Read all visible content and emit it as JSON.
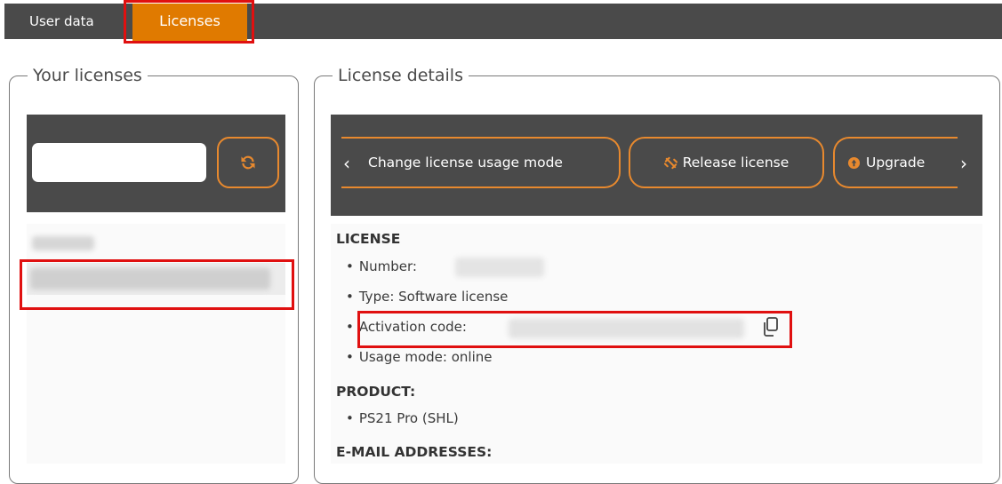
{
  "tabs": {
    "user_data": "User data",
    "licenses": "Licenses"
  },
  "left_panel": {
    "legend": "Your licenses",
    "search": {
      "value": "",
      "placeholder": ""
    },
    "refresh_icon": "refresh-icon"
  },
  "right_panel": {
    "legend": "License details",
    "actions": {
      "prev": "‹",
      "change_mode": "Change license usage mode",
      "release": "Release license",
      "upgrade": "Upgrade",
      "next": "›"
    },
    "license": {
      "title": "LICENSE",
      "number_label": "Number:",
      "type": "Type: Software license",
      "activation_label": "Activation code:",
      "usage_mode": "Usage mode: online"
    },
    "product": {
      "title": "PRODUCT:",
      "name": "PS21 Pro (SHL)"
    },
    "email": {
      "title": "E-MAIL ADDRESSES:"
    }
  },
  "colors": {
    "accent": "#e07a00",
    "bar": "#4a4a4a",
    "highlight": "#e01010"
  }
}
